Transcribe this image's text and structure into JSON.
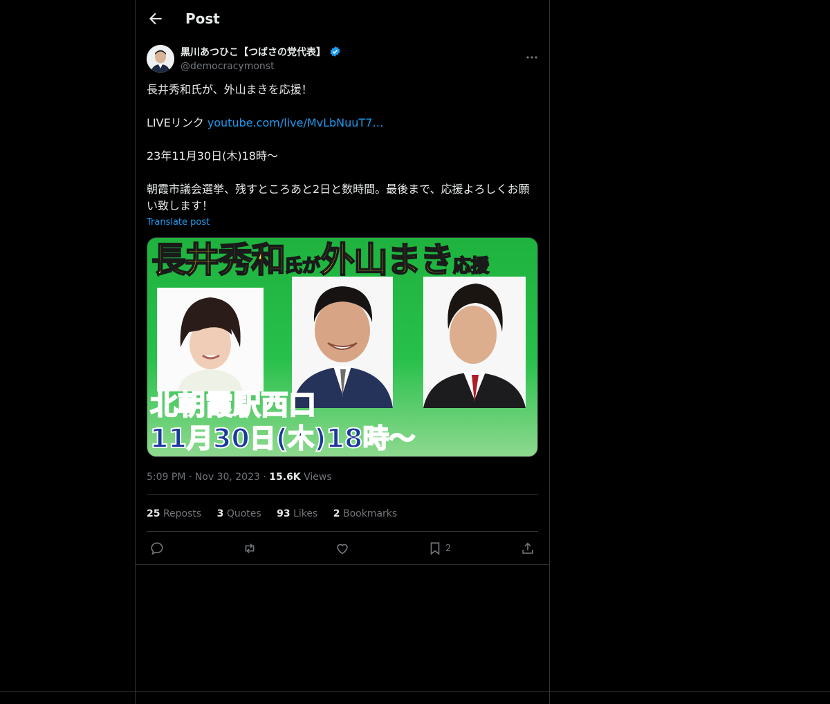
{
  "header": {
    "title": "Post"
  },
  "author": {
    "name": "黒川あつひこ【つばさの党代表】",
    "handle": "@democracymonst"
  },
  "post": {
    "line1": "長井秀和氏が、外山まきを応援！",
    "live_prefix": "LIVEリンク ",
    "live_link": "youtube.com/live/MvLbNuuT7…",
    "line3": "23年11月30日(木)18時〜",
    "line4": "朝霞市議会選挙、残すところあと2日と数時間。最後まで、応援よろしくお願い致します！",
    "translate": "Translate post"
  },
  "media": {
    "title_a": "長井秀和",
    "title_b": "氏が",
    "title_c": "外山まき",
    "title_d": "応援",
    "place": "北朝霞駅西口",
    "datetime": "11月30日(木)18時〜"
  },
  "meta": {
    "time": "5:09 PM",
    "dot": "·",
    "date": "Nov 30, 2023",
    "views_count": "15.6K",
    "views_label": "Views"
  },
  "stats": {
    "reposts_count": "25",
    "reposts_label": "Reposts",
    "quotes_count": "3",
    "quotes_label": "Quotes",
    "likes_count": "93",
    "likes_label": "Likes",
    "bookmarks_count": "2",
    "bookmarks_label": "Bookmarks"
  },
  "actions": {
    "bookmark_count": "2"
  },
  "colors": {
    "accent": "#1d9bf0",
    "muted": "#71767b",
    "border": "#2f3336"
  },
  "icons": [
    "back-arrow-icon",
    "verified-badge-icon",
    "more-icon",
    "reply-icon",
    "repost-icon",
    "like-icon",
    "bookmark-icon",
    "share-icon"
  ]
}
